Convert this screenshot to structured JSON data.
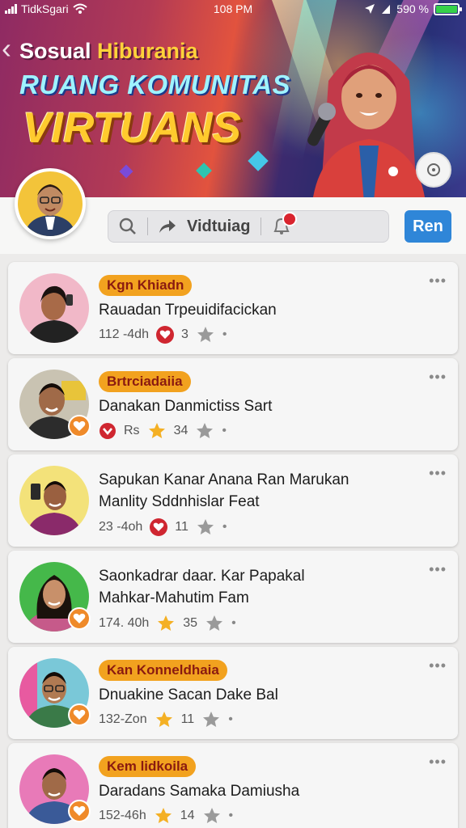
{
  "status_bar": {
    "carrier": "TidkSgari",
    "time": "108 PM",
    "battery": "590 %"
  },
  "hero": {
    "title_part1": "Sosual",
    "title_part2": "Hiburania",
    "subtitle": "RUANG KOMUNITAS",
    "headline": "VIRTUANS"
  },
  "search": {
    "label": "Vidtuiag"
  },
  "action_button": {
    "label": "Ren",
    "color": "#2f86d8"
  },
  "posts": [
    {
      "tag": "Kgn Khiadn",
      "title_lines": [
        "Rauadan Trpeuidifacickan"
      ],
      "meta_text": "112 -4dh",
      "reaction_type": "red",
      "count": "3",
      "badge": false
    },
    {
      "tag": "Brtrciadaiia",
      "title_lines": [
        "Danakan Danmictiss Sart"
      ],
      "meta_text": "Rs",
      "reaction_type": "star",
      "count": "34",
      "badge": true
    },
    {
      "tag": "",
      "title_lines": [
        "Sapukan Kanar Anana Ran Marukan",
        "Manlity  Sddnhislar Feat"
      ],
      "meta_text": "23 -4oh",
      "reaction_type": "red",
      "count": "11",
      "badge": false
    },
    {
      "tag": "",
      "title_lines": [
        "Saonkadrar daar. Kar Papakal",
        "Mahkar-Mahutim Fam"
      ],
      "meta_text": "174. 40h",
      "reaction_type": "star",
      "count": "35",
      "badge": true
    },
    {
      "tag": "Kan Konneldhaia",
      "title_lines": [
        "Dnuakine Sacan Dake Bal"
      ],
      "meta_text": "132-Zon",
      "reaction_type": "star",
      "count": "11",
      "badge": true
    },
    {
      "tag": "Kem lidkoila",
      "title_lines": [
        "Daradans Samaka Damiusha"
      ],
      "meta_text": "152-46h",
      "reaction_type": "star",
      "count": "14",
      "badge": true
    }
  ]
}
